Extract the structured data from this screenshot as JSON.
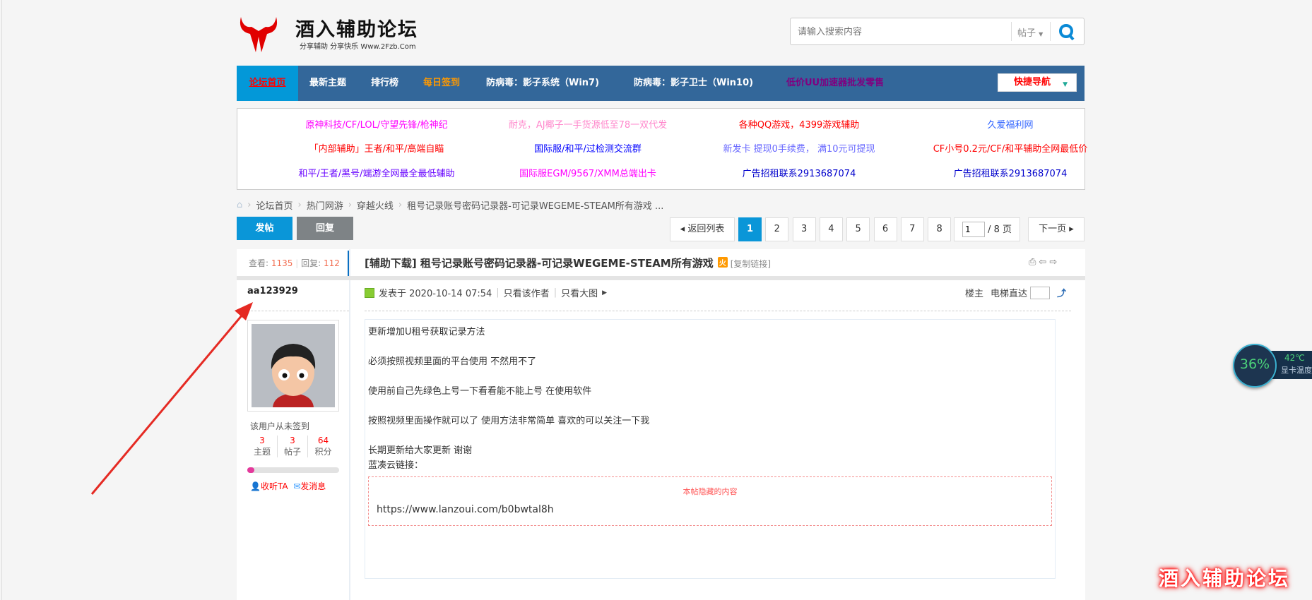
{
  "header": {
    "logo_title": "酒入辅助论坛",
    "logo_subtitle": "分享辅助 分享快乐 Www.2Fzb.Com",
    "search_placeholder": "请输入搜索内容",
    "search_type": "帖子"
  },
  "nav": {
    "items": [
      "论坛首页",
      "最新主题",
      "排行榜",
      "每日签到",
      "防病毒：影子系统（Win7)",
      "防病毒：影子卫士（Win10)",
      "低价UU加速器批发零售"
    ],
    "quick_nav": "快捷导航"
  },
  "ads": [
    [
      {
        "text": "原神科技/CF/LOL/守望先锋/枪神纪",
        "color": "#ff00ff"
      },
      {
        "text": "耐克，AJ椰子一手货源低至78一双代发",
        "color": "#ff88cc"
      },
      {
        "text": "各种QQ游戏，4399游戏辅助",
        "color": "#ff0000"
      },
      {
        "text": "久爱福利网",
        "color": "#3366ff"
      }
    ],
    [
      {
        "text": "「内部辅助」王者/和平/高端自瞄",
        "color": "#ff0000"
      },
      {
        "text": "国际服/和平/过检测交流群",
        "color": "#0000ff"
      },
      {
        "text": "新发卡 提现0手续费， 满10元可提现",
        "color": "#6666ff"
      },
      {
        "text": "CF小号0.2元/CF/和平辅助全网最低价",
        "color": "#ff0000"
      }
    ],
    [
      {
        "text": "和平/王者/黑号/端游全网最全最低辅助",
        "color": "#6600ff"
      },
      {
        "text": "国际服EGM/9567/XMM总端出卡",
        "color": "#ff00ff"
      },
      {
        "text": "广告招租联系2913687074",
        "color": "#0000cc"
      },
      {
        "text": "广告招租联系2913687074",
        "color": "#0000cc"
      }
    ]
  ],
  "breadcrumb": [
    "论坛首页",
    "热门网游",
    "穿越火线",
    "租号记录账号密码记录器-可记录WEGEME-STEAM所有游戏 ..."
  ],
  "actions": {
    "post": "发帖",
    "reply": "回复"
  },
  "pagination": {
    "back": "返回列表",
    "pages": [
      "1",
      "2",
      "3",
      "4",
      "5",
      "6",
      "7",
      "8"
    ],
    "current": "1",
    "input": "1",
    "total": "/ 8 页",
    "next": "下一页"
  },
  "thread": {
    "views_label": "查看:",
    "views": "1135",
    "replies_label": "回复:",
    "replies": "112",
    "title": "[辅助下载] 租号记录账号密码记录器-可记录WEGEME-STEAM所有游戏",
    "hot": "火",
    "copy_link": "[复制链接]"
  },
  "author": {
    "name": "aa123929",
    "sign_status": "该用户从未签到",
    "stats": [
      {
        "value": "3",
        "label": "主题"
      },
      {
        "value": "3",
        "label": "帖子"
      },
      {
        "value": "64",
        "label": "积分"
      }
    ],
    "progress": 0.08,
    "follow": "收听TA",
    "message": "发消息"
  },
  "post": {
    "meta": "发表于 2020-10-14 07:54",
    "only_author": "只看该作者",
    "only_images": "只看大图",
    "floor": "楼主",
    "jump": "电梯直达",
    "lines": [
      "更新增加U租号获取记录方法",
      "必须按照视频里面的平台使用 不然用不了",
      "使用前自己先绿色上号一下看看能不能上号 在使用软件",
      "按照视频里面操作就可以了 使用方法非常简单 喜欢的可以关注一下我",
      "长期更新给大家更新 谢谢",
      "蓝凑云链接："
    ],
    "hidden_title": "本帖隐藏的内容",
    "hidden_url": "https://www.lanzoui.com/b0bwtal8h"
  },
  "widget": {
    "percent": "36%",
    "temp": "42℃",
    "label": "显卡温度"
  },
  "watermark": "酒入辅助论坛"
}
